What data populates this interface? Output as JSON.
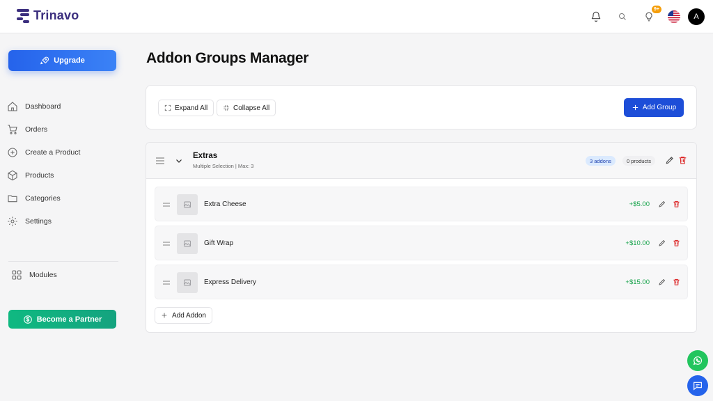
{
  "header": {
    "brand": "Trinavo",
    "notification_badge": "9+",
    "avatar_initial": "A"
  },
  "sidebar": {
    "upgrade_label": "Upgrade",
    "items": [
      {
        "label": "Dashboard",
        "icon": "home-icon"
      },
      {
        "label": "Orders",
        "icon": "cart-icon"
      },
      {
        "label": "Create a Product",
        "icon": "plus-circle-icon"
      },
      {
        "label": "Products",
        "icon": "box-icon"
      },
      {
        "label": "Categories",
        "icon": "folder-icon"
      },
      {
        "label": "Settings",
        "icon": "gear-icon"
      }
    ],
    "modules_label": "Modules",
    "partner_label": "Become a Partner"
  },
  "main": {
    "title": "Addon Groups Manager",
    "toolbar": {
      "expand_label": "Expand All",
      "collapse_label": "Collapse All",
      "add_group_label": "Add Group"
    },
    "group": {
      "name": "Extras",
      "subtitle": "Multiple Selection | Max: 3",
      "addons_count": "3 addons",
      "products_count": "0 products",
      "addons": [
        {
          "name": "Extra Cheese",
          "price": "+$5.00"
        },
        {
          "name": "Gift Wrap",
          "price": "+$10.00"
        },
        {
          "name": "Express Delivery",
          "price": "+$15.00"
        }
      ],
      "add_addon_label": "Add Addon"
    }
  },
  "colors": {
    "brand": "#3b2e7e",
    "primary": "#1d4ed8",
    "success": "#16a34a",
    "danger": "#dc2626",
    "whatsapp": "#22c55e"
  }
}
